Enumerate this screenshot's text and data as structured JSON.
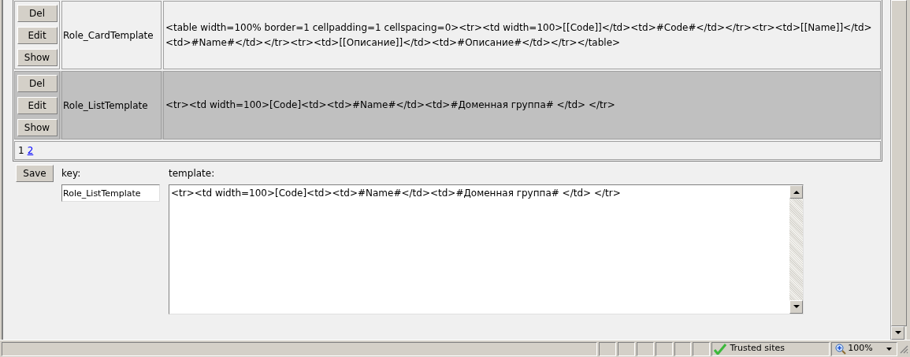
{
  "table": {
    "rows": [
      {
        "buttons": [
          "Del",
          "Edit",
          "Show"
        ],
        "key": "Role_CardTemplate",
        "template": "<table width=100% border=1 cellpadding=1 cellspacing=0><tr><td width=100>[[Code]]</td><td>#Code#</td></tr><tr><td>[[Name]]</td><td>#Name#</td></tr><tr><td>[[Описание]]</td><td>#Описание#</td></tr></table>",
        "selected": false
      },
      {
        "buttons": [
          "Del",
          "Edit",
          "Show"
        ],
        "key": "Role_ListTemplate",
        "template": "<tr><td width=100>[Code]<td><td>#Name#</td><td>#Доменная группа# </td> </tr>",
        "selected": true
      }
    ],
    "pager": [
      {
        "label": "1",
        "selected": true
      },
      {
        "label": "2",
        "selected": false
      }
    ]
  },
  "form": {
    "save_button": "Save",
    "key_label": "key:",
    "template_label": "template:",
    "key_value": "Role_ListTemplate",
    "template_value": "<tr><td width=100>[Code]<td><td>#Name#</td><td>#Доменная группа# </td> </tr>"
  },
  "status_bar": {
    "zone": "Trusted sites",
    "zoom": "100%"
  }
}
